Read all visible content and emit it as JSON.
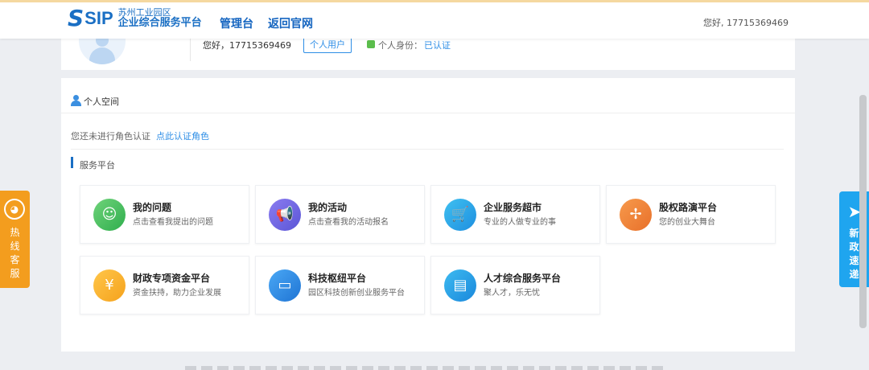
{
  "header": {
    "logo_mark": "S",
    "logo_abbr": "SIP",
    "logo_line1": "苏州工业园区",
    "logo_line2": "企业综合服务平台",
    "nav": [
      "管理台",
      "返回官网"
    ],
    "greeting": "您好, 17715369469"
  },
  "profile": {
    "hello": "您好，17715369469",
    "user_type": "个人用户",
    "identity_label": "个人身份：",
    "identity_status": "已认证"
  },
  "space": {
    "title": "个人空间",
    "role_message": "您还未进行角色认证",
    "role_link": "点此认证角色",
    "services_title": "服务平台"
  },
  "services": [
    {
      "title": "我的问题",
      "desc": "点击查看我提出的问题",
      "icon": "headset-icon",
      "color": "#2fae4d"
    },
    {
      "title": "我的活动",
      "desc": "点击查看我的活动报名",
      "icon": "megaphone-icon",
      "color": "#5a55d6"
    },
    {
      "title": "企业服务超市",
      "desc": "专业的人做专业的事",
      "icon": "cart-icon",
      "color": "#1e8fe0"
    },
    {
      "title": "股权路演平台",
      "desc": "您的创业大舞台",
      "icon": "pinwheel-icon",
      "color": "#e8702a"
    },
    {
      "title": "财政专项资金平台",
      "desc": "资金扶持，助力企业发展",
      "icon": "coins-icon",
      "color": "#f5a21c"
    },
    {
      "title": "科技枢纽平台",
      "desc": "园区科技创新创业服务平台",
      "icon": "monitor-icon",
      "color": "#1f74d4"
    },
    {
      "title": "人才综合服务平台",
      "desc": "聚人才，乐无忧",
      "icon": "document-icon",
      "color": "#1a88dc"
    }
  ],
  "side": {
    "hotline": "热线客服",
    "news": "新政速递"
  }
}
